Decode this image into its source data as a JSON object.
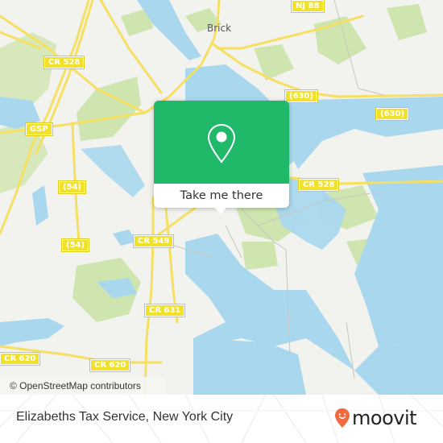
{
  "map": {
    "place_labels": [
      {
        "id": "brick",
        "text": "Brick"
      }
    ],
    "road_shields": [
      {
        "id": "nj88",
        "text": "NJ 88"
      },
      {
        "id": "cr528-top",
        "text": "CR 528"
      },
      {
        "id": "gsp",
        "text": "GSP"
      },
      {
        "id": "630-a",
        "text": "(630)"
      },
      {
        "id": "630-b",
        "text": "(630)"
      },
      {
        "id": "54-a",
        "text": "(54)"
      },
      {
        "id": "54-b",
        "text": "(54)"
      },
      {
        "id": "cr528-right",
        "text": "CR 528"
      },
      {
        "id": "cr549",
        "text": "CR 549"
      },
      {
        "id": "cr631",
        "text": "CR 631"
      },
      {
        "id": "cr620-a",
        "text": "CR 620"
      },
      {
        "id": "cr620-b",
        "text": "CR 620"
      }
    ],
    "attribution": "© OpenStreetMap contributors",
    "colors": {
      "land": "#f2f2ee",
      "water": "#a9d8ee",
      "park": "#cfe5b0",
      "road": "#f5e063",
      "accent": "#20b96a"
    }
  },
  "popup": {
    "icon": "map-pin-icon",
    "button_label": "Take me there"
  },
  "footer": {
    "title": "Elizabeths Tax Service, New York City",
    "logo_text": "moovit",
    "logo_icon": "moovit-pin-face-icon",
    "logo_color": "#f26a3d"
  }
}
